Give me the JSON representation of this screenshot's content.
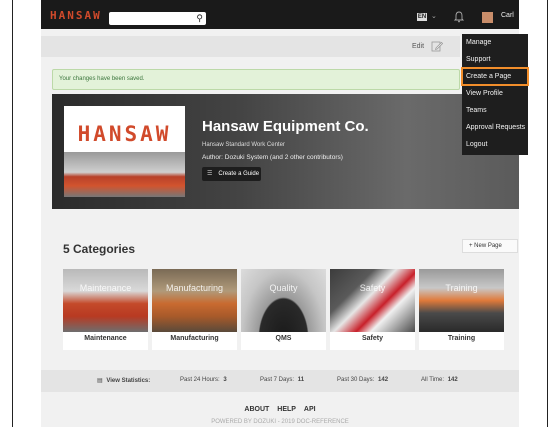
{
  "nav": {
    "logo": "HANSAW",
    "search_placeholder": "",
    "language": "EN",
    "user_name": "Carl"
  },
  "user_menu": {
    "items": [
      {
        "label": "Manage"
      },
      {
        "label": "Support"
      },
      {
        "label": "Create a Page",
        "highlighted": true
      },
      {
        "label": "View Profile"
      },
      {
        "label": "Teams"
      },
      {
        "label": "Approval Requests"
      },
      {
        "label": "Logout"
      }
    ],
    "highlight_color": "#f28e2b"
  },
  "header": {
    "edit_label": "Edit"
  },
  "alert": {
    "text": "Your changes have been saved."
  },
  "hero": {
    "logo_text": "HANSAW",
    "title": "Hansaw Equipment Co.",
    "subtitle": "Hansaw Standard Work Center",
    "author": "Author: Dozuki System (and 2 other contributors)",
    "create_guide_label": "Create a Guide"
  },
  "categories": {
    "heading": "5 Categories",
    "new_page_label": "+ New Page",
    "items": [
      {
        "label": "Maintenance",
        "overlay": "Maintenance"
      },
      {
        "label": "Manufacturing",
        "overlay": "Manufacturing"
      },
      {
        "label": "QMS",
        "overlay": "Quality"
      },
      {
        "label": "Safety",
        "overlay": "Safety"
      },
      {
        "label": "Training",
        "overlay": "Training"
      }
    ]
  },
  "stats": {
    "view_label": "View Statistics:",
    "past24_label": "Past 24 Hours:",
    "past24_value": "3",
    "past7_label": "Past 7 Days:",
    "past7_value": "11",
    "past30_label": "Past 30 Days:",
    "past30_value": "142",
    "all_label": "All Time:",
    "all_value": "142"
  },
  "footer": {
    "links": [
      "ABOUT",
      "HELP",
      "API"
    ],
    "powered": "POWERED BY DOZUKI - 2019 DOC-REFERENCE"
  },
  "colors": {
    "brand": "#d14a2b",
    "nav_bg": "#1a1a1a",
    "alert_bg": "#e3f2d9"
  }
}
